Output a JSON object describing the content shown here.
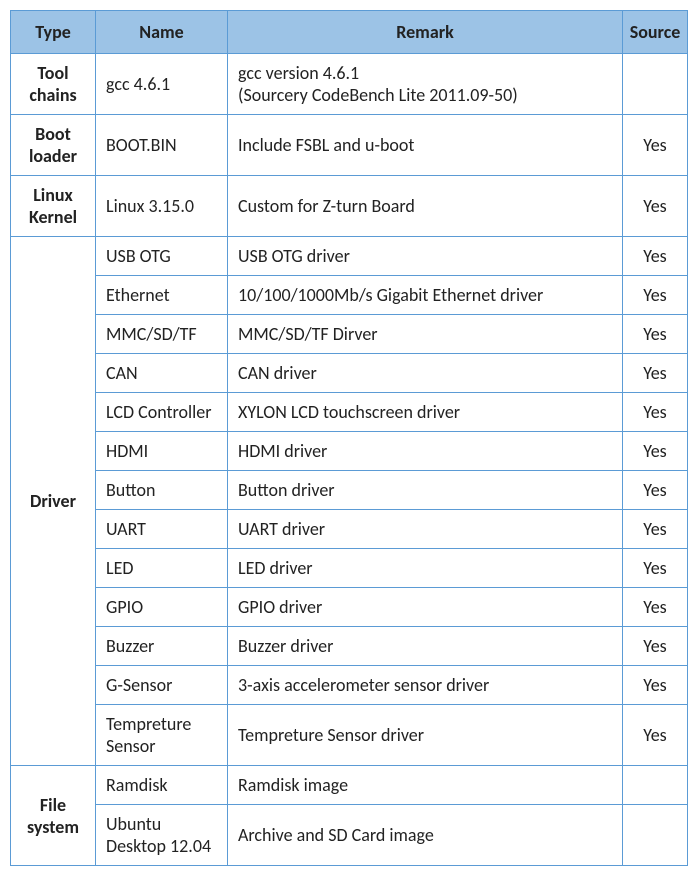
{
  "headers": {
    "type": "Type",
    "name": "Name",
    "remark": "Remark",
    "source": "Source"
  },
  "rows": [
    {
      "group": "Tool chains",
      "groupSpan": 1,
      "name": "gcc 4.6.1",
      "remark": "gcc version 4.6.1\n(Sourcery CodeBench Lite 2011.09-50)",
      "source": ""
    },
    {
      "group": "Boot loader",
      "groupSpan": 1,
      "name": "BOOT.BIN",
      "remark": "Include FSBL and u-boot",
      "source": "Yes"
    },
    {
      "group": "Linux Kernel",
      "groupSpan": 1,
      "name": "Linux 3.15.0",
      "remark": "Custom for Z-turn Board",
      "source": "Yes"
    },
    {
      "group": "Driver",
      "groupSpan": 13,
      "name": "USB OTG",
      "remark": "USB OTG driver",
      "source": "Yes"
    },
    {
      "name": "Ethernet",
      "remark": "10/100/1000Mb/s Gigabit Ethernet driver",
      "source": "Yes"
    },
    {
      "name": "MMC/SD/TF",
      "remark": "MMC/SD/TF Dirver",
      "source": "Yes"
    },
    {
      "name": "CAN",
      "remark": "CAN driver",
      "source": "Yes"
    },
    {
      "name": "LCD Controller",
      "remark": "XYLON LCD touchscreen driver",
      "source": "Yes"
    },
    {
      "name": "HDMI",
      "remark": "HDMI driver",
      "source": "Yes"
    },
    {
      "name": "Button",
      "remark": "Button driver",
      "source": "Yes"
    },
    {
      "name": "UART",
      "remark": "UART driver",
      "source": "Yes"
    },
    {
      "name": "LED",
      "remark": "LED driver",
      "source": "Yes"
    },
    {
      "name": "GPIO",
      "remark": "GPIO driver",
      "source": "Yes"
    },
    {
      "name": "Buzzer",
      "remark": "Buzzer driver",
      "source": "Yes"
    },
    {
      "name": "G-Sensor",
      "remark": "3-axis accelerometer sensor driver",
      "source": "Yes"
    },
    {
      "name": "Tempreture Sensor",
      "remark": "Tempreture Sensor driver",
      "source": "Yes"
    },
    {
      "group": "File system",
      "groupSpan": 2,
      "name": "Ramdisk",
      "remark": "Ramdisk image",
      "source": ""
    },
    {
      "name": "Ubuntu Desktop 12.04",
      "remark": "Archive and SD Card image",
      "source": ""
    }
  ]
}
